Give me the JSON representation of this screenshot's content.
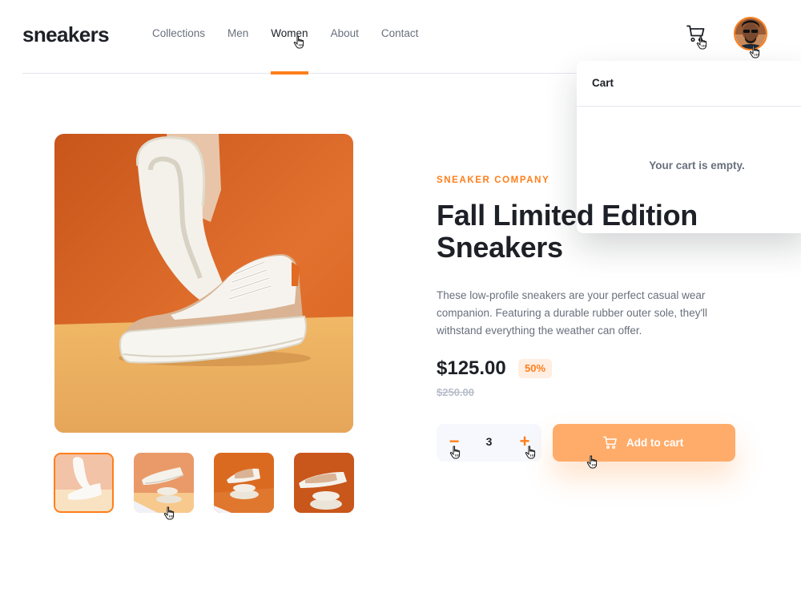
{
  "header": {
    "logo": "sneakers",
    "nav": [
      "Collections",
      "Men",
      "Women",
      "About",
      "Contact"
    ],
    "active_nav": "Women",
    "cart_icon": "cart-icon",
    "avatar": "user-avatar"
  },
  "cart_popover": {
    "title": "Cart",
    "empty_message": "Your cart is empty."
  },
  "gallery": {
    "selected_index": 0,
    "thumbnails": [
      "product-thumbnail-1",
      "product-thumbnail-2",
      "product-thumbnail-3",
      "product-thumbnail-4"
    ]
  },
  "product": {
    "company": "SNEAKER COMPANY",
    "title": "Fall Limited Edition Sneakers",
    "description": "These low-profile sneakers are your perfect casual wear companion. Featuring a durable rubber outer sole, they'll withstand everything the weather can offer.",
    "price": "$125.00",
    "discount": "50%",
    "original_price": "$250.00"
  },
  "quantity": {
    "minus": "−",
    "value": "3",
    "plus": "+"
  },
  "add_to_cart": {
    "label": "Add to cart",
    "icon": "cart-icon"
  },
  "colors": {
    "accent": "#ff7e1b",
    "accent_pale": "#ffeee2",
    "button": "#ffac6a",
    "text_dark": "#1d2026",
    "text_gray": "#69707d"
  }
}
